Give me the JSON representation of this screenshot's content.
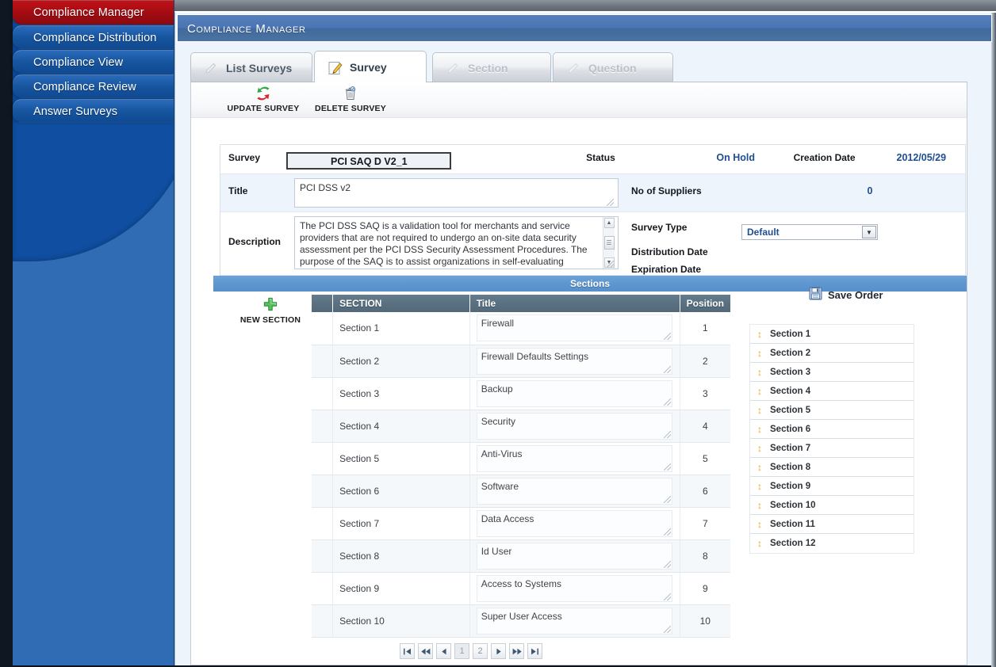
{
  "sidebar": {
    "items": [
      {
        "label": "Compliance Manager",
        "active": true
      },
      {
        "label": "Compliance Distribution",
        "active": false
      },
      {
        "label": "Compliance View",
        "active": false
      },
      {
        "label": "Compliance Review",
        "active": false
      },
      {
        "label": "Answer Surveys",
        "active": false
      }
    ]
  },
  "window": {
    "title": "Compliance Manager"
  },
  "tabs": [
    {
      "label": "List Surveys",
      "state": "normal",
      "icon": "pencil-icon"
    },
    {
      "label": "Survey",
      "state": "selected",
      "icon": "pencil-icon"
    },
    {
      "label": "Section",
      "state": "disabled",
      "icon": "pencil-icon"
    },
    {
      "label": "Question",
      "state": "disabled",
      "icon": "pencil-icon"
    }
  ],
  "toolbar": {
    "update_label": "UPDATE SURVEY",
    "update_icon": "refresh-icon",
    "delete_label": "DELETE SURVEY",
    "delete_icon": "trash-icon"
  },
  "survey": {
    "label_survey": "Survey",
    "name": "PCI SAQ D V2_1",
    "label_status": "Status",
    "status": "On Hold",
    "label_creation_date": "Creation Date",
    "creation_date": "2012/05/29",
    "label_title": "Title",
    "title": "PCI DSS v2",
    "label_suppliers": "No of Suppliers",
    "suppliers": "0",
    "label_description": "Description",
    "description": "The PCI DSS SAQ is a validation tool for merchants and service providers that are not required to undergo an on-site data security assessment per the PCI DSS Security Assessment Procedures. The purpose of the SAQ is to assist organizations in self-evaluating compliance with the PCI DSS, and you may be required to share it with your acquiring bank. Please consult your acquirer for",
    "label_survey_type": "Survey Type",
    "survey_type": "Default",
    "survey_type_options": [
      "Default"
    ],
    "label_distribution_date": "Distribution Date",
    "distribution_date": "",
    "label_expiration_date": "Expiration Date",
    "expiration_date": ""
  },
  "sections": {
    "bar_title": "Sections",
    "new_section_label": "NEW SECTION",
    "new_section_icon": "plus-icon",
    "columns": {
      "handle": "",
      "name": "SECTION",
      "title": "Title",
      "position": "Position"
    },
    "rows": [
      {
        "name": "Section 1",
        "title": "Firewall",
        "position": "1"
      },
      {
        "name": "Section 2",
        "title": "Firewall Defaults Settings",
        "position": "2"
      },
      {
        "name": "Section 3",
        "title": "Backup",
        "position": "3"
      },
      {
        "name": "Section 4",
        "title": "Security",
        "position": "4"
      },
      {
        "name": "Section 5",
        "title": "Anti-Virus",
        "position": "5"
      },
      {
        "name": "Section 6",
        "title": "Software",
        "position": "6"
      },
      {
        "name": "Section 7",
        "title": "Data Access",
        "position": "7"
      },
      {
        "name": "Section 8",
        "title": "Id User",
        "position": "8"
      },
      {
        "name": "Section 9",
        "title": "Access to Systems",
        "position": "9"
      },
      {
        "name": "Section 10",
        "title": "Super User Access",
        "position": "10"
      }
    ]
  },
  "order_panel": {
    "save_order_label": "Save Order",
    "save_order_icon": "save-icon",
    "items": [
      "Section 1",
      "Section 2",
      "Section 3",
      "Section 4",
      "Section 5",
      "Section 6",
      "Section 7",
      "Section 8",
      "Section 9",
      "Section 10",
      "Section 11",
      "Section 12"
    ]
  },
  "pager": {
    "first_icon": "first-page-icon",
    "prev_fast_icon": "prev-fast-icon",
    "prev_icon": "prev-page-icon",
    "pages": [
      "1",
      "2"
    ],
    "current_page": "1",
    "next_icon": "next-page-icon",
    "next_fast_icon": "next-fast-icon",
    "last_icon": "last-page-icon"
  },
  "colors": {
    "sidebar_blue": "#2f6cb3",
    "sidebar_blob": "#0f4ea0",
    "active_nav_red": "#c01118",
    "titlebar_blue": "#4a75b2",
    "sections_bar_blue": "#5e96ce",
    "table_header_gray": "#5a7182",
    "accent_text_blue": "#1d4e91"
  }
}
